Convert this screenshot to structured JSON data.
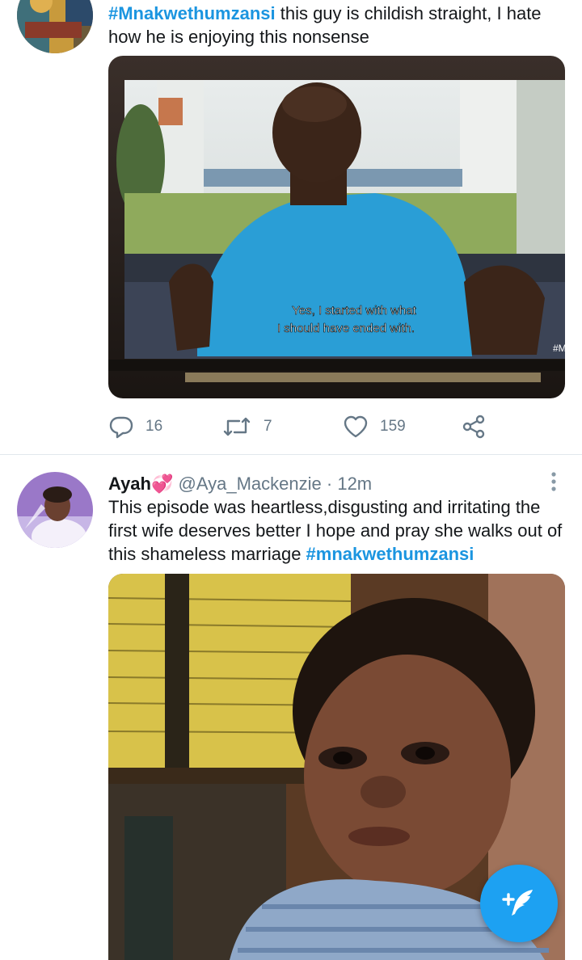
{
  "tweet1": {
    "hashtag": "#Mnakwethumzansi",
    "text": " this guy is childish straight, I hate how he is enjoying this nonsense",
    "media": {
      "subtitle_line1": "Yes, I started with what",
      "subtitle_line2": "I should have ended with.",
      "watermark": "#M"
    },
    "actions": {
      "replies": "16",
      "retweets": "7",
      "likes": "159"
    }
  },
  "tweet2": {
    "name": "Ayah",
    "emoji": "💞",
    "handle": "@Aya_Mackenzie",
    "separator": " · ",
    "time": "12m",
    "more_icon": "more-vertical-icon",
    "text": "This episode was heartless,disgusting and irritating  the first wife deserves better I hope and pray she walks out of this shameless marriage ",
    "hashtag": "#mnakwethumzansi"
  },
  "fab": {
    "icon": "compose-tweet-icon",
    "plus": "+"
  },
  "colors": {
    "accent": "#1da1f2",
    "hashtag": "#1b95e0",
    "muted": "#657786"
  }
}
